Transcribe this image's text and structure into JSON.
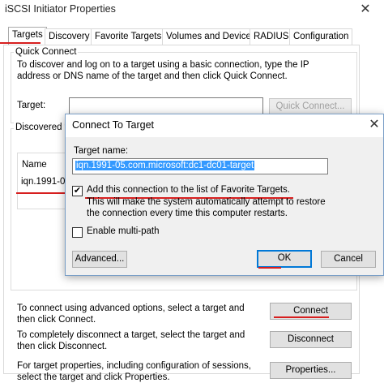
{
  "window": {
    "title": "iSCSI Initiator Properties",
    "close_glyph": "✕"
  },
  "tabs": [
    {
      "label": "Targets"
    },
    {
      "label": "Discovery"
    },
    {
      "label": "Favorite Targets"
    },
    {
      "label": "Volumes and Devices"
    },
    {
      "label": "RADIUS"
    },
    {
      "label": "Configuration"
    }
  ],
  "quick_connect": {
    "group_label": "Quick Connect",
    "description": "To discover and log on to a target using a basic connection, type the IP address or DNS name of the target and then click Quick Connect.",
    "target_label": "Target:",
    "target_value": "",
    "button_label": "Quick Connect..."
  },
  "discovered": {
    "group_label": "Discovered ta",
    "column_name": "Name",
    "row_name": "iqn.1991-05"
  },
  "bottom": {
    "connect_text": "To connect using advanced options, select a target and then click Connect.",
    "connect_button": "Connect",
    "disconnect_text": "To completely disconnect a target, select the target and then click Disconnect.",
    "disconnect_button": "Disconnect",
    "properties_text": "For target properties, including configuration of sessions, select the target and click Properties.",
    "properties_button": "Properties..."
  },
  "dialog": {
    "title": "Connect To Target",
    "close_glyph": "✕",
    "target_name_label": "Target name:",
    "target_name_value": "iqn.1991-05.com.microsoft:dc1-dc01-target",
    "favorite_label": "Add this connection to the list of Favorite Targets.",
    "favorite_desc": "This will make the system automatically attempt to restore the connection every time this computer restarts.",
    "favorite_checked": true,
    "multipath_label": "Enable multi-path",
    "multipath_checked": false,
    "advanced_button": "Advanced...",
    "ok_button": "OK",
    "cancel_button": "Cancel"
  },
  "colors": {
    "annotation_red": "#d71f1f",
    "selection_blue": "#3399ff",
    "default_button_border": "#0078d7"
  }
}
